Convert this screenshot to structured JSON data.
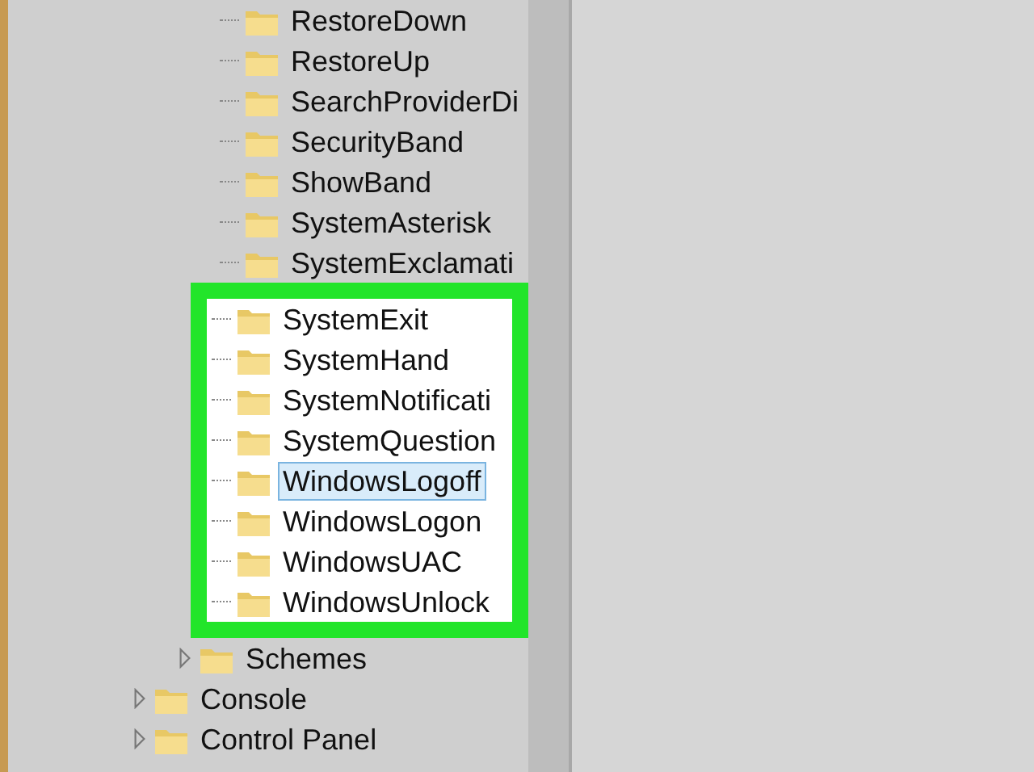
{
  "tree": [
    {
      "children": [
        {
          "children": [
            {
              "label": "RestoreDown",
              "selected": false,
              "highlighted": false
            },
            {
              "label": "RestoreUp",
              "selected": false,
              "highlighted": false
            },
            {
              "label": "SearchProviderDi",
              "selected": false,
              "highlighted": false
            },
            {
              "label": "SecurityBand",
              "selected": false,
              "highlighted": false
            },
            {
              "label": "ShowBand",
              "selected": false,
              "highlighted": false
            },
            {
              "label": "SystemAsterisk",
              "selected": false,
              "highlighted": false
            },
            {
              "label": "SystemExclamati",
              "selected": false,
              "highlighted": false
            },
            {
              "label": "SystemExit",
              "selected": false,
              "highlighted": true
            },
            {
              "label": "SystemHand",
              "selected": false,
              "highlighted": true
            },
            {
              "label": "SystemNotificati",
              "selected": false,
              "highlighted": true
            },
            {
              "label": "SystemQuestion",
              "selected": false,
              "highlighted": true
            },
            {
              "label": "WindowsLogoff",
              "selected": true,
              "highlighted": true
            },
            {
              "label": "WindowsLogon",
              "selected": false,
              "highlighted": true
            },
            {
              "label": "WindowsUAC",
              "selected": false,
              "highlighted": true
            },
            {
              "label": "WindowsUnlock",
              "selected": false,
              "highlighted": true
            }
          ]
        },
        {
          "label": "Schemes",
          "selected": false,
          "highlighted": false,
          "expanded": false
        }
      ]
    },
    {
      "label": "Console",
      "selected": false,
      "highlighted": false,
      "expanded": false
    },
    {
      "label": "Control Panel",
      "selected": false,
      "highlighted": false,
      "expanded": false
    }
  ]
}
